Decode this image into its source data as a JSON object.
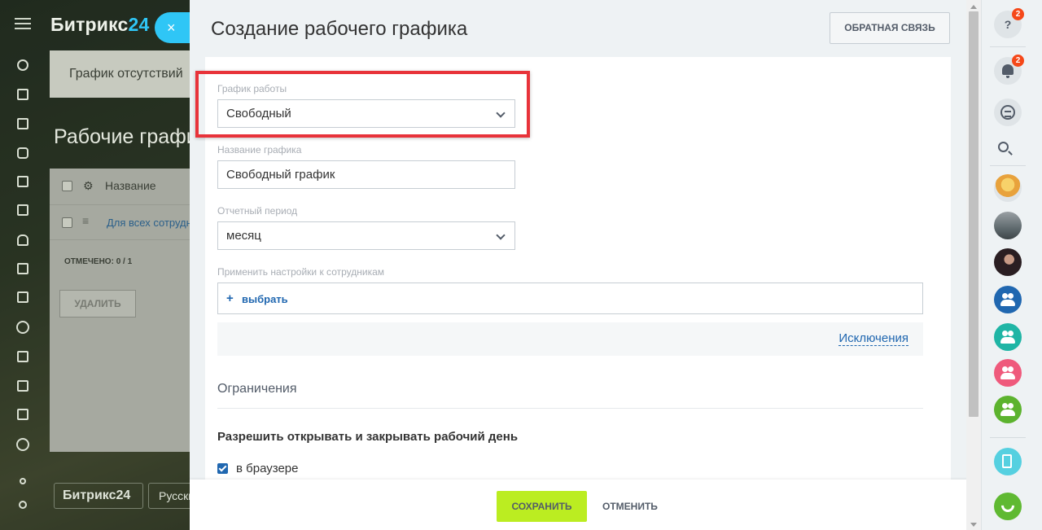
{
  "background": {
    "logo_text": "Битрикс",
    "logo_24": "24",
    "close_symbol": "×",
    "tab_label": "График отсутствий",
    "page_title": "Рабочие графики",
    "grid": {
      "column_name": "Название",
      "row_link": "Для всех сотрудников",
      "selected_counter": "ОТМЕЧЕНО: 0 / 1",
      "delete_button": "УДАЛИТЬ"
    },
    "footer_logo": "Битрикс24",
    "footer_lang": "Русский"
  },
  "slider": {
    "title": "Создание рабочего графика",
    "feedback_button": "ОБРАТНАЯ СВЯЗЬ",
    "schedule_type": {
      "label": "График работы",
      "value": "Свободный"
    },
    "schedule_name": {
      "label": "Название графика",
      "value": "Свободный график"
    },
    "report_period": {
      "label": "Отчетный период",
      "value": "месяц"
    },
    "employees": {
      "label": "Применить настройки к сотрудникам",
      "plus": "+",
      "pick_link": "выбрать"
    },
    "exceptions_link": "Исключения",
    "restrictions_title": "Ограничения",
    "allow_subhead": "Разрешить открывать и закрывать рабочий день",
    "browser_checkbox": {
      "label": "в браузере",
      "checked": true
    },
    "save_button": "СОХРАНИТЬ",
    "cancel_button": "ОТМЕНИТЬ"
  },
  "right_panel": {
    "help_symbol": "?",
    "help_badge": "2",
    "notifications_badge": "2"
  },
  "colors": {
    "accent_blue": "#2fc6f6",
    "link_blue": "#2067b0",
    "save_green": "#bbed21",
    "highlight_red": "#e8333a",
    "badge_red": "#f54819"
  }
}
